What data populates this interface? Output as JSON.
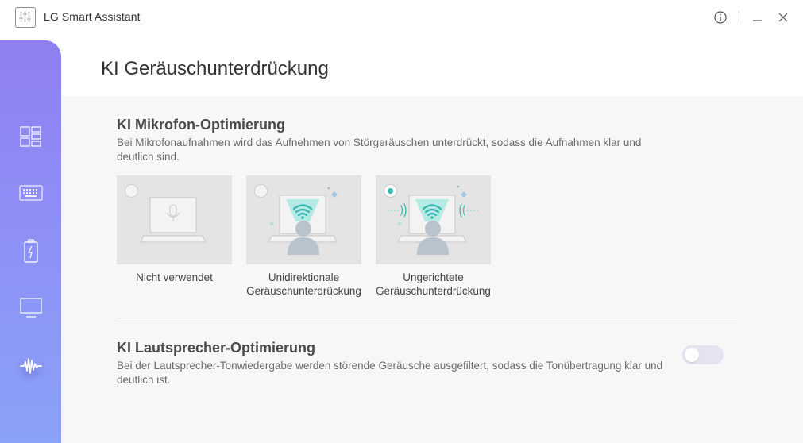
{
  "window": {
    "title": "LG Smart Assistant",
    "icons": [
      "sliders-icon",
      "info-icon",
      "minimize-icon",
      "close-icon"
    ]
  },
  "sidebar": {
    "items": [
      {
        "icon": "dashboard-icon",
        "active": false
      },
      {
        "icon": "keyboard-icon",
        "active": false
      },
      {
        "icon": "battery-icon",
        "active": false
      },
      {
        "icon": "monitor-icon",
        "active": false
      },
      {
        "icon": "audio-wave-icon",
        "active": true
      }
    ]
  },
  "page": {
    "title": "KI Geräuschunterdrückung"
  },
  "mic": {
    "title": "KI Mikrofon-Optimierung",
    "description": "Bei Mikrofonaufnahmen wird das Aufnehmen von Störgeräuschen unterdrückt, sodass die Aufnahmen klar und deutlich sind.",
    "options": [
      {
        "label": "Nicht verwendet",
        "selected": false
      },
      {
        "label": "Unidirektionale Geräuschunterdrückung",
        "selected": false
      },
      {
        "label": "Ungerichtete Geräuschunterdrückung",
        "selected": true
      }
    ]
  },
  "speaker": {
    "title": "KI Lautsprecher-Optimierung",
    "description": "Bei der Lautsprecher-Tonwiedergabe werden störende Geräusche ausgefiltert, sodass die Tonübertragung klar und deutlich ist.",
    "enabled": false
  },
  "colors": {
    "accent": "#35b8b1",
    "sidebar_top": "#8f7ff2",
    "sidebar_bottom": "#8aa2f7",
    "toggle_off": "#e5e3ef"
  }
}
